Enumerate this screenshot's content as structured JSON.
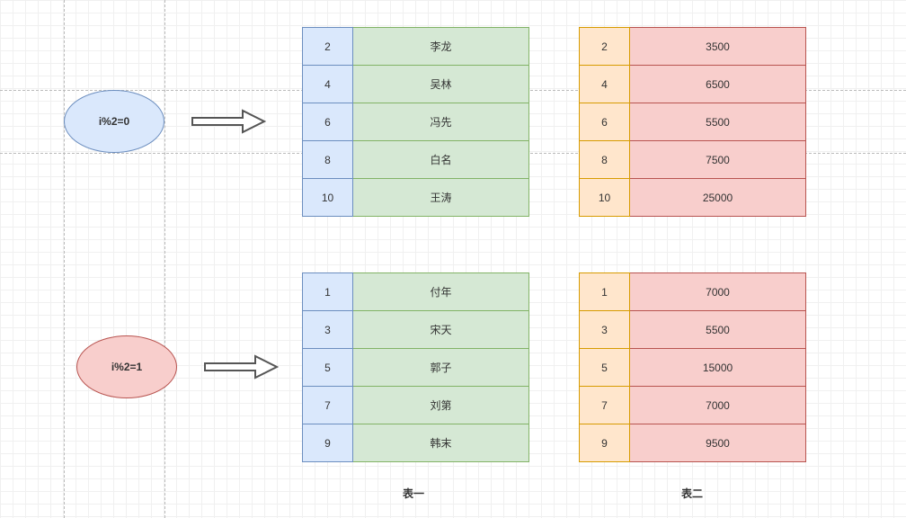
{
  "conditions": {
    "even": "i%2=0",
    "odd": "i%2=1"
  },
  "table1": {
    "label": "表一",
    "even": [
      {
        "index": "2",
        "value": "李龙"
      },
      {
        "index": "4",
        "value": "吴林"
      },
      {
        "index": "6",
        "value": "冯先"
      },
      {
        "index": "8",
        "value": "白名"
      },
      {
        "index": "10",
        "value": "王涛"
      }
    ],
    "odd": [
      {
        "index": "1",
        "value": "付年"
      },
      {
        "index": "3",
        "value": "宋天"
      },
      {
        "index": "5",
        "value": "郭子"
      },
      {
        "index": "7",
        "value": "刘第"
      },
      {
        "index": "9",
        "value": "韩末"
      }
    ]
  },
  "table2": {
    "label": "表二",
    "even": [
      {
        "index": "2",
        "value": "3500"
      },
      {
        "index": "4",
        "value": "6500"
      },
      {
        "index": "6",
        "value": "5500"
      },
      {
        "index": "8",
        "value": "7500"
      },
      {
        "index": "10",
        "value": "25000"
      }
    ],
    "odd": [
      {
        "index": "1",
        "value": "7000"
      },
      {
        "index": "3",
        "value": "5500"
      },
      {
        "index": "5",
        "value": "15000"
      },
      {
        "index": "7",
        "value": "7000"
      },
      {
        "index": "9",
        "value": "9500"
      }
    ]
  }
}
